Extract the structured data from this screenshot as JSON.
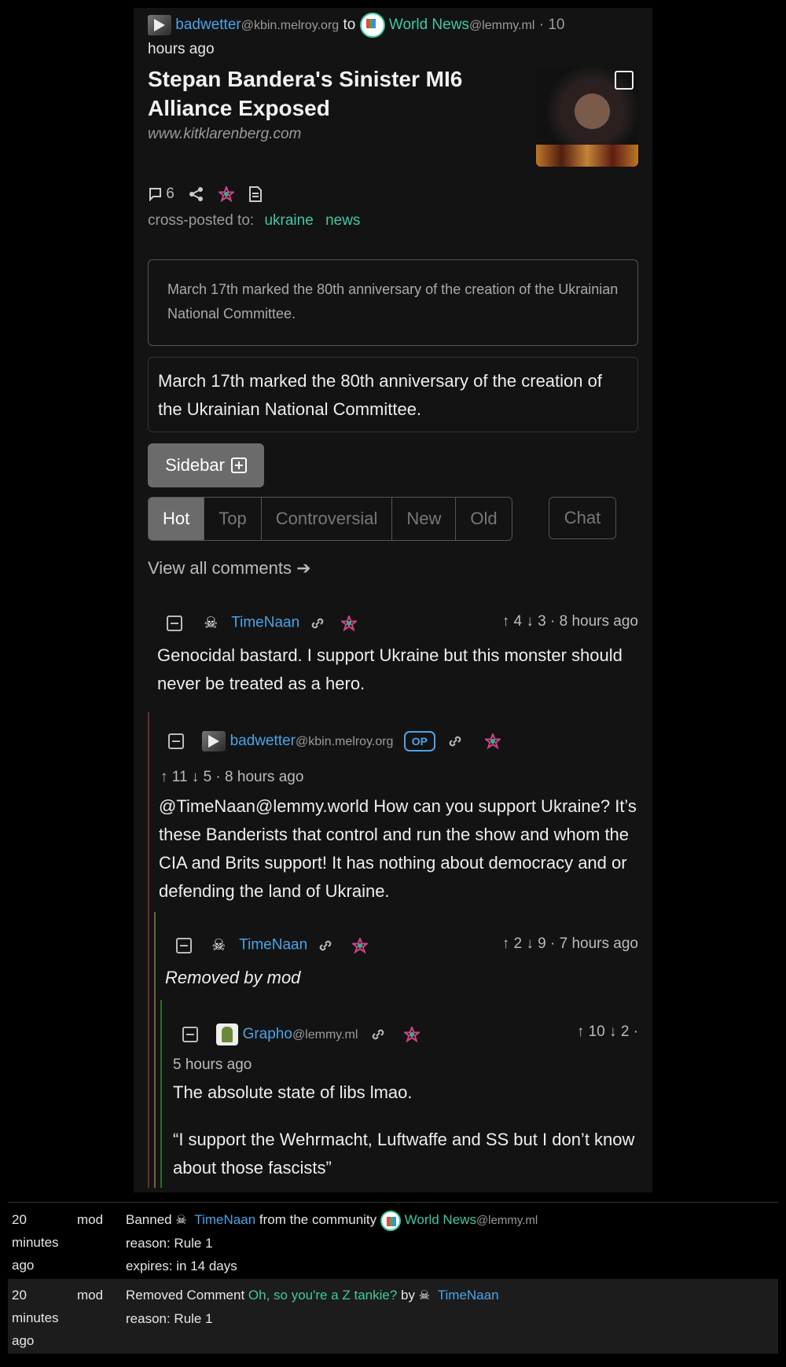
{
  "post": {
    "author": "badwetter",
    "author_instance": "@kbin.melroy.org",
    "to": "to",
    "community": "World News",
    "community_instance": "@lemmy.ml",
    "time_line1": "· 10",
    "time_line2": "hours ago",
    "title": "Stepan Bandera's Sinister MI6 Alliance Exposed",
    "domain": "www.kitklarenberg.com",
    "comment_count": "6",
    "crosspost_label": "cross-posted to:",
    "crosspost_1": "ukraine",
    "crosspost_2": "news",
    "summary_box": "March 17th marked the 80th anniversary of the creation of the Ukrainian National Committee.",
    "body": "March 17th marked the 80th anniversary of the creation of the Ukrainian National Committee."
  },
  "sidebar_button": "Sidebar",
  "sort": {
    "hot": "Hot",
    "top": "Top",
    "controversial": "Controversial",
    "new": "New",
    "old": "Old",
    "chat": "Chat"
  },
  "view_all": "View all comments ➔",
  "comments": [
    {
      "user": "TimeNaan",
      "up": "4",
      "down": "3",
      "time": "8 hours ago",
      "text": "Genocidal bastard. I support Ukraine but this monster should never be treated as a hero."
    },
    {
      "user": "badwetter",
      "instance": "@kbin.melroy.org",
      "badge": "OP",
      "up": "11",
      "down": "5",
      "time": "8 hours ago",
      "text": "@TimeNaan@lemmy.world How can you support Ukraine? It’s these Banderists that control and run the show and whom the CIA and Brits support! It has nothing about democracy and or defending the land of Ukraine."
    },
    {
      "user": "TimeNaan",
      "up": "2",
      "down": "9",
      "time": "7 hours ago",
      "text": "Removed by mod"
    },
    {
      "user": "Grapho",
      "instance": "@lemmy.ml",
      "up": "10",
      "down": "2",
      "time": "5 hours ago",
      "text1": "The absolute state of libs lmao.",
      "text2": "“I support the Wehrmacht, Luftwaffe and SS but I don’t know about those fascists”"
    }
  ],
  "modlog": [
    {
      "when": "20 minutes ago",
      "role": "mod",
      "action": "Banned",
      "user": "TimeNaan",
      "from_text": "from the community",
      "community": "World News",
      "community_instance": "@lemmy.ml",
      "reason": "reason: Rule 1",
      "expires": "expires: in 14 days"
    },
    {
      "when": "20 minutes ago",
      "role": "mod",
      "action": "Removed Comment",
      "comment": "Oh, so you're a Z tankie?",
      "by": "by",
      "user": "TimeNaan",
      "reason": "reason: Rule 1"
    }
  ]
}
